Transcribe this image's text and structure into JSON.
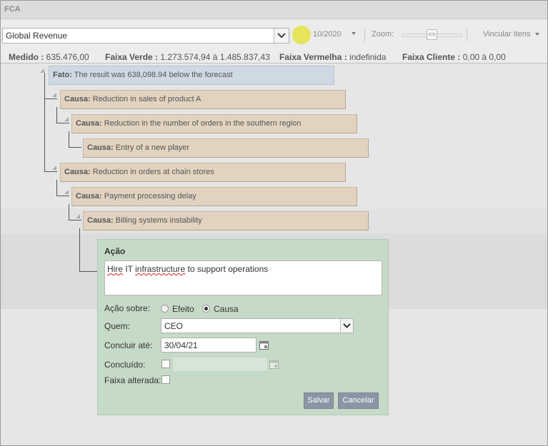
{
  "window": {
    "title": "FCA"
  },
  "toolbar": {
    "indicator_value": "Global Revenue",
    "period": "10/2020",
    "zoom_label": "Zoom:",
    "link_label": "Vincular Itens"
  },
  "status": {
    "medido_label": "Medido :",
    "medido_value": "635.476,00",
    "verde_label": "Faixa Verde :",
    "verde_value": "1.273.574,94 à 1.485.837,43",
    "vermelha_label": "Faixa Vermelha :",
    "vermelha_value": "indefinida",
    "cliente_label": "Faixa Cliente :",
    "cliente_value": "0,00 à 0,00"
  },
  "tree": {
    "fact": {
      "label": "Fato:",
      "text": "The result was 638,098.94 below the forecast"
    },
    "causes": [
      {
        "label": "Causa:",
        "text": "Reduction in sales of product A"
      },
      {
        "label": "Causa:",
        "text": "Reduction in the number of orders in the southern region"
      },
      {
        "label": "Causa:",
        "text": "Entry of a new player"
      },
      {
        "label": "Causa:",
        "text": "Reduction in orders at chain stores"
      },
      {
        "label": "Causa:",
        "text": "Payment processing delay"
      },
      {
        "label": "Causa:",
        "text": "Billing systems instability"
      }
    ]
  },
  "dialog": {
    "title": "Ação",
    "description_part1": "Hire",
    "description_part2": " IT ",
    "description_part3": "infrastructure",
    "description_part4": " to support operations",
    "acao_sobre_label": "Ação sobre:",
    "option_efeito": "Efeito",
    "option_causa": "Causa",
    "selected_option": "Causa",
    "quem_label": "Quem:",
    "quem_value": "CEO",
    "concluir_label": "Concluir até:",
    "concluir_value": "30/04/21",
    "concluido_label": "Concluído:",
    "faixa_label": "Faixa alterada:",
    "save_label": "Salvar",
    "cancel_label": "Cancelar"
  }
}
